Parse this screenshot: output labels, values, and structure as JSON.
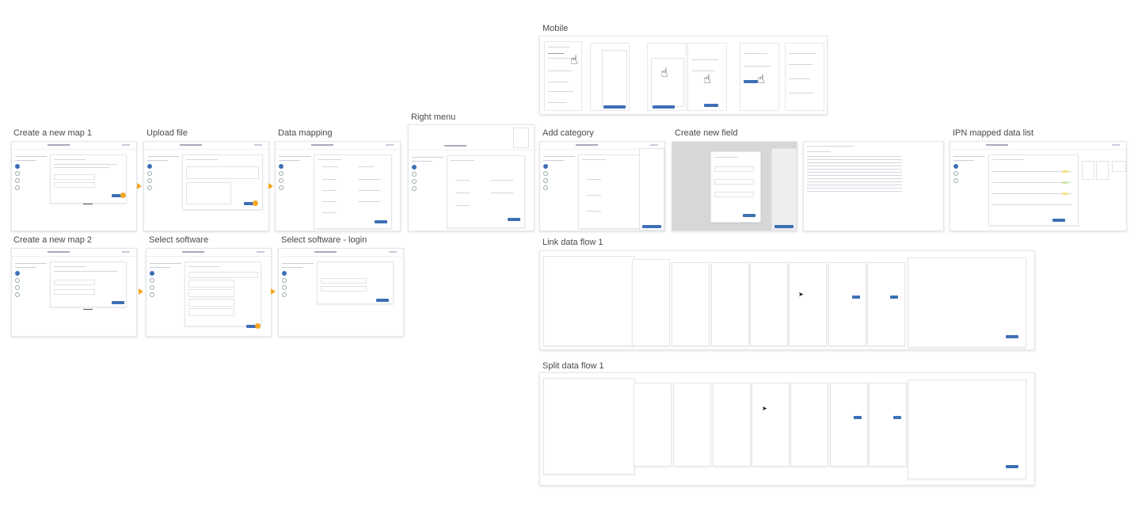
{
  "canvas": {
    "section_labels": {
      "mobile": "Mobile",
      "right_menu": "Right menu",
      "create_map_1": "Create a new map 1",
      "upload_file": "Upload file",
      "data_mapping": "Data mapping",
      "add_category": "Add category",
      "create_new_field": "Create new field",
      "ipn_list": "IPN mapped data list",
      "create_map_2": "Create a new map 2",
      "select_software": "Select software",
      "select_software_login": "Select software - login",
      "link_data_flow": "Link data flow 1",
      "split_data_flow": "Split data flow 1"
    },
    "colors": {
      "accent": "#f5a623",
      "primary": "#3d6fb6",
      "frame_border": "#e3e6ea"
    },
    "icons": {
      "flow_arrow": "orange-arrow-right-icon",
      "tap": "pointing-hand-icon",
      "pointer": "mouse-cursor-icon"
    },
    "tap_glyph": "☝",
    "cursor_glyph": "➤"
  }
}
